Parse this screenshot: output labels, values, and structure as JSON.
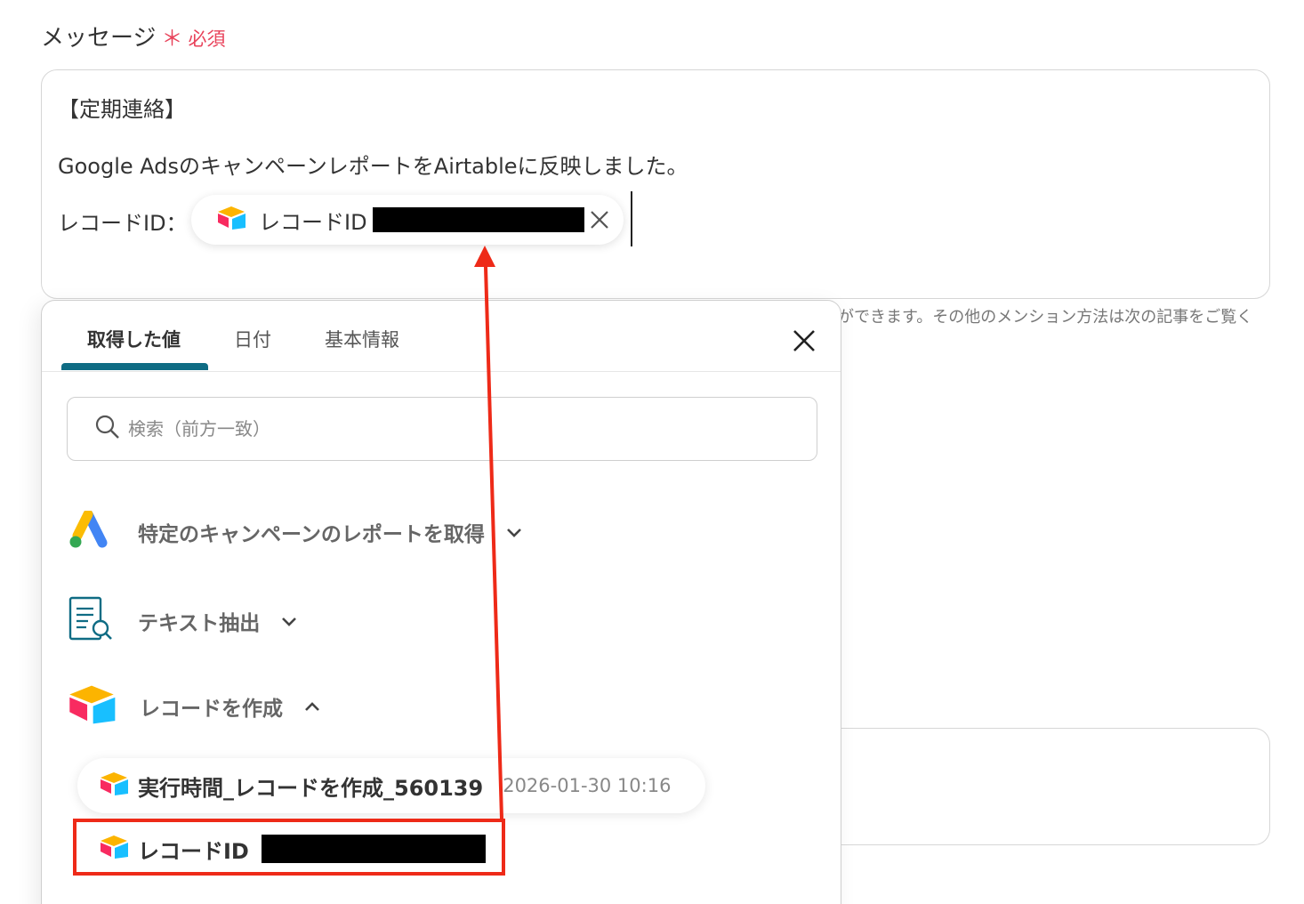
{
  "field": {
    "title": "メッセージ",
    "required_mark": "＊",
    "required_text": "必須"
  },
  "editor": {
    "line1": "【定期連絡】",
    "line2": "Google Adsのキャンペーンレポートを​Airtableに反映しました。",
    "line3_label": "レコードID：",
    "chip_label": "レコードID"
  },
  "helper_text": "ができます。その他のメンション方法は次の記事をご覧く",
  "popover": {
    "tabs": [
      {
        "label": "取得した値",
        "active": true
      },
      {
        "label": "日付",
        "active": false
      },
      {
        "label": "基本情報",
        "active": false
      }
    ],
    "search_placeholder": "検索（前方一致）",
    "groups": [
      {
        "label": "特定のキャンペーンのレポートを取得",
        "icon": "google-ads-icon",
        "expanded": false
      },
      {
        "label": "テキスト抽出",
        "icon": "text-extract-icon",
        "expanded": false
      },
      {
        "label": "レコードを作成",
        "icon": "airtable-icon",
        "expanded": true
      }
    ],
    "items": [
      {
        "name": "実行時間_レコードを作成_560139",
        "value": "2026-01-30 10:16"
      },
      {
        "name": "レコードID",
        "value": ""
      }
    ]
  },
  "colors": {
    "accent": "#0f6c84",
    "required": "#e8425a",
    "annotation": "#ee2a18"
  }
}
